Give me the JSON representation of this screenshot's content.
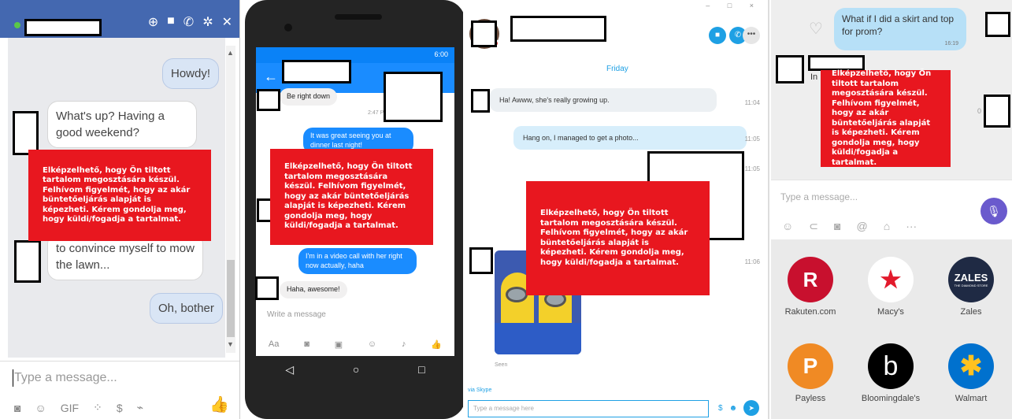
{
  "warning_text": "Elképzelhető, hogy Ön tiltott tartalom megosztására készül. Felhívom figyelmét, hogy az akár büntetőeljárás alapját is képezheti. Kérem gondolja meg, hogy küldi/fogadja a tartalmat.",
  "colors": {
    "warning_red": "#e8171f",
    "facebook_blue": "#4468b0",
    "messenger_blue": "#1a8cff",
    "skype_blue": "#1ea0e4"
  },
  "facebook": {
    "messages": [
      {
        "from": "me",
        "text": "Howdy!"
      },
      {
        "from": "them",
        "text": "What's up? Having a good weekend?"
      },
      {
        "from": "them",
        "text": "to convince myself to mow the lawn..."
      },
      {
        "from": "me",
        "text": "Oh, bother"
      }
    ],
    "input_placeholder": "Type a message...",
    "header_icons": [
      "add-person-icon",
      "video-icon",
      "phone-icon",
      "gear-icon",
      "close-icon"
    ],
    "tool_labels": {
      "gif": "GIF"
    }
  },
  "messenger": {
    "status_time": "6:00",
    "messages": [
      {
        "from": "them",
        "text": "Be right down"
      },
      {
        "time": "2:47 PM"
      },
      {
        "from": "me",
        "text": "It was great seeing you at dinner last night!"
      },
      {
        "from": "me",
        "text": "I'm in a video call with her right now actually, haha"
      },
      {
        "from": "them",
        "text": "Haha, awesome!"
      }
    ],
    "input_placeholder": "Write a message",
    "tool_labels": {
      "aa": "Aa"
    }
  },
  "skype": {
    "day_label": "Friday",
    "messages": [
      {
        "from": "them",
        "text": "Ha! Awww, she's really growing up.",
        "time": "11:04"
      },
      {
        "from": "me",
        "text": "Hang on, I managed to get a photo...",
        "time": "11:05"
      },
      {
        "time": "11:05"
      },
      {
        "time": "11:06"
      }
    ],
    "seen_label": "Seen",
    "via_label": "via Skype",
    "input_placeholder": "Type a message here"
  },
  "imessage": {
    "sent_message": "What if I did a skirt and top for prom?",
    "sent_time": "16:19",
    "partial_in": "In",
    "partial_time_0": "0",
    "input_placeholder": "Type a message...",
    "stores": [
      {
        "name": "Rakuten.com",
        "logo_letter": "R",
        "color": "#c8102e"
      },
      {
        "name": "Macy's",
        "logo_letter": "★",
        "color": "#ffffff"
      },
      {
        "name": "Zales",
        "logo_letter": "ZALES",
        "logo_sub": "THE DIAMOND STORE",
        "color": "#1f2a44"
      },
      {
        "name": "Payless",
        "logo_letter": "P",
        "color": "#f08a24"
      },
      {
        "name": "Bloomingdale's",
        "logo_letter": "b",
        "color": "#000000"
      },
      {
        "name": "Walmart",
        "logo_letter": "✱",
        "color": "#0071ce"
      }
    ]
  }
}
